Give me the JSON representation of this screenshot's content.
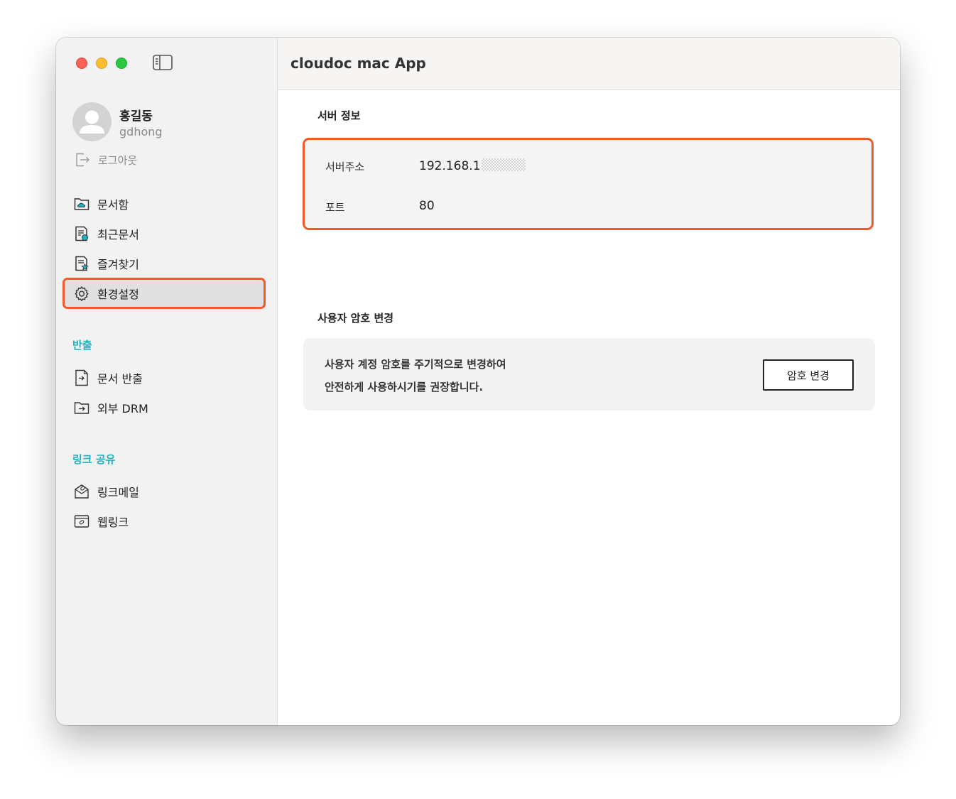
{
  "app": {
    "title": "cloudoc mac App"
  },
  "user": {
    "name": "홍길동",
    "id": "gdhong",
    "logout_label": "로그아웃"
  },
  "sidebar": {
    "main_items": [
      {
        "label": "문서함",
        "icon": "cloud-folder-icon"
      },
      {
        "label": "최근문서",
        "icon": "recent-document-icon"
      },
      {
        "label": "즐겨찾기",
        "icon": "star-document-icon"
      },
      {
        "label": "환경설정",
        "icon": "gear-icon",
        "active": true
      }
    ],
    "export_section": {
      "title": "반출",
      "items": [
        {
          "label": "문서 반출",
          "icon": "document-export-icon"
        },
        {
          "label": "외부 DRM",
          "icon": "folder-export-icon"
        }
      ]
    },
    "link_section": {
      "title": "링크 공유",
      "items": [
        {
          "label": "링크메일",
          "icon": "link-mail-icon"
        },
        {
          "label": "웹링크",
          "icon": "web-link-icon"
        }
      ]
    }
  },
  "server_info": {
    "title": "서버 정보",
    "address_label": "서버주소",
    "address_value": "192.168.1",
    "port_label": "포트",
    "port_value": "80"
  },
  "password_change": {
    "title": "사용자 암호 변경",
    "line1": "사용자 계정 암호를 주기적으로 변경하여",
    "line2": "안전하게 사용하시기를 권장합니다.",
    "button_label": "암호 변경"
  },
  "colors": {
    "accent": "#20b2c2",
    "highlight": "#ef5a2c"
  }
}
